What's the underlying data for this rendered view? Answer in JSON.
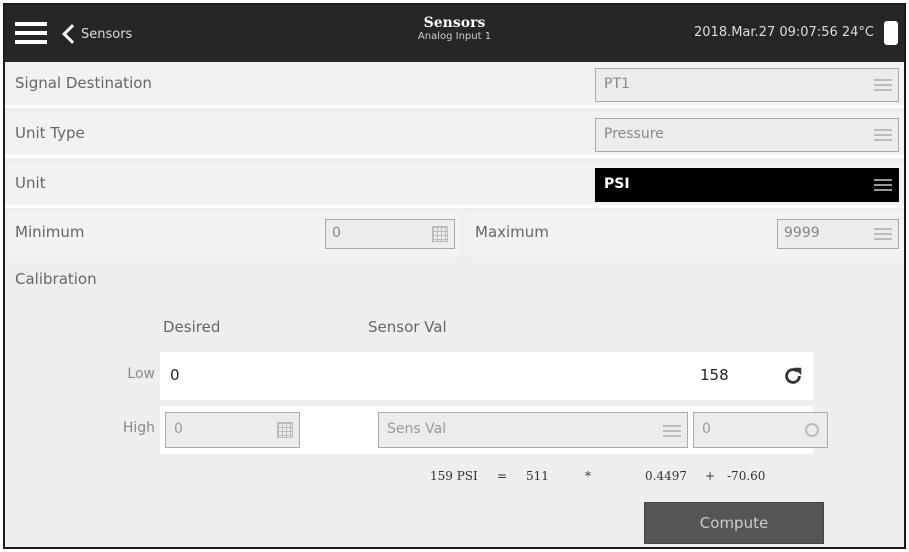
{
  "header": {
    "back_label": "Sensors",
    "title": "Sensors",
    "subtitle": "Analog Input 1",
    "datetime": "2018.Mar.27 09:07:56 24°C"
  },
  "settings": {
    "signal_destination": {
      "label": "Signal Destination",
      "value": "PT1"
    },
    "unit_type": {
      "label": "Unit Type",
      "value": "Pressure"
    },
    "unit": {
      "label": "Unit",
      "value": "PSI"
    },
    "minimum": {
      "label": "Minimum",
      "value": "0"
    },
    "maximum": {
      "label": "Maximum",
      "value": "9999"
    }
  },
  "calibration": {
    "label": "Calibration",
    "col_desired": "Desired",
    "col_sensor": "Sensor Val",
    "low": {
      "label": "Low",
      "desired": "0",
      "sensor": "158"
    },
    "high": {
      "label": "High",
      "desired": "0",
      "sensor_select": "Sens Val",
      "sensor": "0"
    },
    "formula": {
      "result": "159 PSI",
      "eq": "=",
      "raw": "511",
      "times": "*",
      "gain": "0.4497",
      "plus": "+",
      "offset": "-70.60"
    },
    "compute_label": "Compute"
  }
}
